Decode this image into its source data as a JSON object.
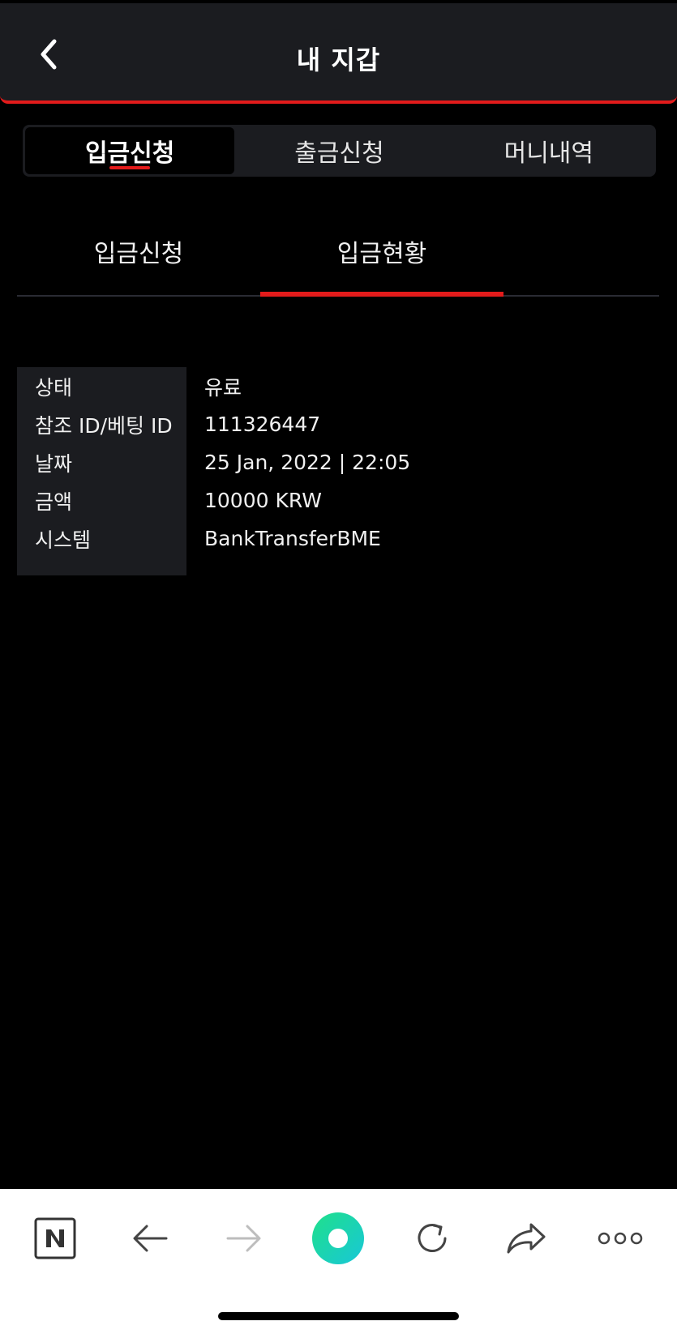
{
  "header": {
    "title": "내 지갑"
  },
  "segment": {
    "items": [
      "입금신청",
      "출금신청",
      "머니내역"
    ],
    "active_index": 0
  },
  "subtabs": {
    "items": [
      "입금신청",
      "입금현황"
    ],
    "active_index": 1
  },
  "details": {
    "rows": [
      {
        "label": "상태",
        "value": "유료"
      },
      {
        "label": "참조 ID/베팅 ID",
        "value": "111326447"
      },
      {
        "label": "날짜",
        "value": "25 Jan, 2022 | 22:05"
      },
      {
        "label": "금액",
        "value": "10000 KRW"
      },
      {
        "label": "시스템",
        "value": "BankTransferBME"
      }
    ]
  },
  "browser_toolbar": {
    "icons": [
      "naver-n-icon",
      "back-arrow-icon",
      "forward-arrow-icon",
      "green-circle-icon",
      "refresh-icon",
      "share-icon",
      "more-icon"
    ],
    "forward_enabled": false
  },
  "colors": {
    "accent": "#e31b1b",
    "panel": "#1b1c20",
    "background": "#000000",
    "toolbar_circle": "#1fd3a0"
  }
}
